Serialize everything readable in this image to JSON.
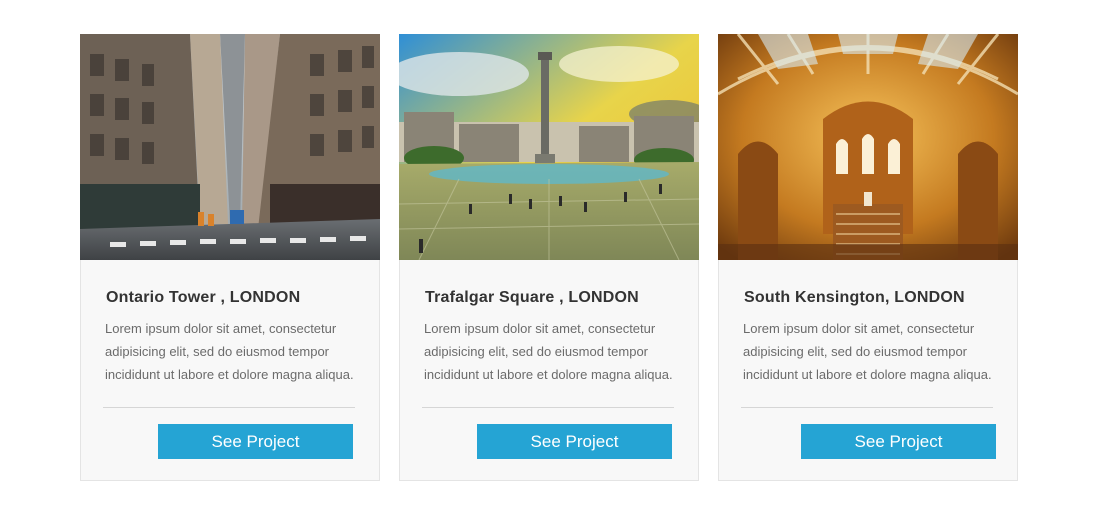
{
  "cards": [
    {
      "title": "Ontario Tower , LONDON",
      "description": "Lorem ipsum dolor sit amet, consectetur adipisicing elit, sed do eiusmod tempor incididunt ut labore et dolore magna aliqua.",
      "button_label": "See Project",
      "image_subject": "city street with skyscrapers"
    },
    {
      "title": "Trafalgar Square , LONDON",
      "description": "Lorem ipsum dolor sit amet, consectetur adipisicing elit, sed do eiusmod tempor incididunt ut labore et dolore magna aliqua.",
      "button_label": "See Project",
      "image_subject": "square with column monument"
    },
    {
      "title": "South Kensington, LONDON",
      "description": "Lorem ipsum dolor sit amet, consectetur adipisicing elit, sed do eiusmod tempor incididunt ut labore et dolore magna aliqua.",
      "button_label": "See Project",
      "image_subject": "museum hall with arched glass ceiling"
    }
  ],
  "colors": {
    "button": "#25a4d4",
    "card_background": "#f8f8f8",
    "title": "#333333",
    "text": "#6b6b6b"
  }
}
